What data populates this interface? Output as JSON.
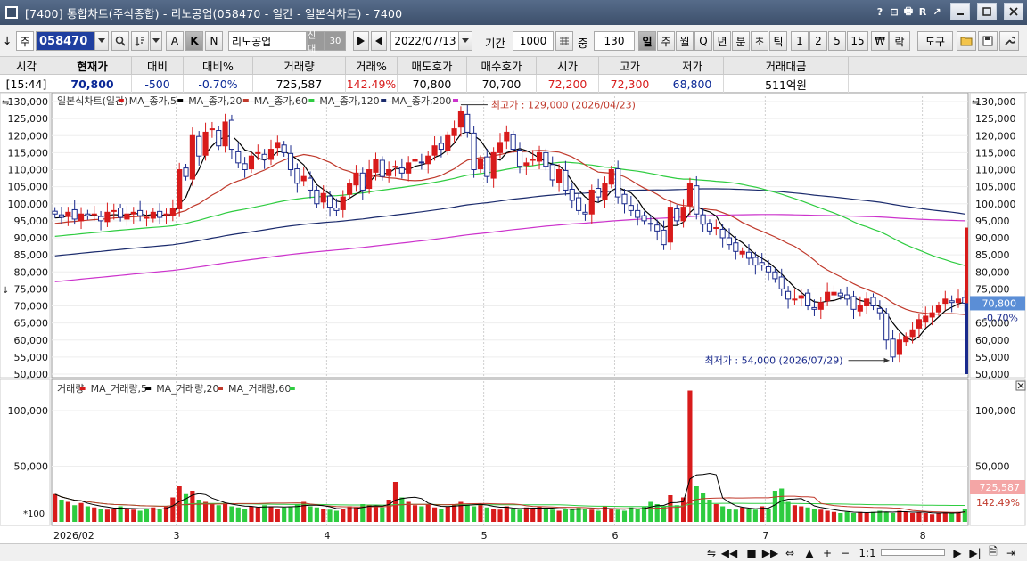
{
  "window": {
    "title": "[7400]  통합차트(주식종합) - 리노공업(058470 - 일간 - 일본식차트) - 7400",
    "title_buttons": [
      "?",
      "⊟",
      "🖶",
      "R",
      "↗"
    ]
  },
  "toolbar": {
    "arrow_left": "↓",
    "jong": "주",
    "code": "058470",
    "k": "K",
    "n": "N",
    "a": "A",
    "name": "리노공업",
    "tag_new": "신대",
    "tag_num": "30",
    "date": "2022/07/13",
    "period_label": "기간",
    "period_value": "1000",
    "count_label": "중",
    "count_value": "130",
    "intervals": [
      "일",
      "주",
      "월",
      "Q",
      "년",
      "분",
      "초",
      "틱",
      "1",
      "2",
      "5",
      "15",
      "₩",
      "락"
    ],
    "active_interval": "일",
    "tools_label": "도구"
  },
  "info": {
    "headers": [
      "시각",
      "현재가",
      "대비",
      "대비%",
      "거래량",
      "거래%",
      "매도호가",
      "매수호가",
      "시가",
      "고가",
      "저가",
      "거래대금"
    ],
    "values": [
      "[15:44]",
      "70,800",
      "-500",
      "-0.70%",
      "725,587",
      "142.49%",
      "70,800",
      "70,700",
      "72,200",
      "72,300",
      "68,800",
      "511억원"
    ],
    "colors": [
      "#000",
      "#0a2896",
      "#0a2896",
      "#0a2896",
      "#000",
      "#d81b1b",
      "#000",
      "#000",
      "#d81b1b",
      "#d81b1b",
      "#0a2896",
      "#000"
    ]
  },
  "price_panel": {
    "legend": [
      {
        "text": "일본식차트(일간)",
        "color": "#d81b1b"
      },
      {
        "text": "MA_종가,5",
        "color": "#000000"
      },
      {
        "text": "MA_종가,20",
        "color": "#c0392b"
      },
      {
        "text": "MA_종가,60",
        "color": "#2ecc40"
      },
      {
        "text": "MA_종가,120",
        "color": "#1a2a6c"
      },
      {
        "text": "MA_종가,200",
        "color": "#cc33cc"
      }
    ],
    "high_annotation": "최고가 : 129,000 (2026/04/23)",
    "low_annotation": "최저가 : 54,000 (2026/07/29)",
    "current_label": "70,800",
    "change_label": "-0.70%"
  },
  "volume_panel": {
    "legend": [
      {
        "text": "거래량",
        "color": "#d81b1b"
      },
      {
        "text": "MA_거래량,5",
        "color": "#000000"
      },
      {
        "text": "MA_거래량,20",
        "color": "#c0392b"
      },
      {
        "text": "MA_거래량,60",
        "color": "#2ecc40"
      }
    ],
    "unit_label": "*100",
    "current_label": "725,587",
    "pct_label": "142.49%"
  },
  "chart_data": {
    "type": "candlestick",
    "price_axis": {
      "ylim": [
        50000,
        130000
      ],
      "ticks": [
        50000,
        55000,
        60000,
        65000,
        70000,
        75000,
        80000,
        85000,
        90000,
        95000,
        100000,
        105000,
        110000,
        115000,
        120000,
        125000,
        130000
      ]
    },
    "volume_axis": {
      "ylim": [
        0,
        120000
      ],
      "ticks": [
        50000,
        100000
      ]
    },
    "x_labels": [
      {
        "text": "2026/02",
        "index": 0
      },
      {
        "text": "3",
        "index": 19
      },
      {
        "text": "4",
        "index": 42
      },
      {
        "text": "5",
        "index": 66
      },
      {
        "text": "6",
        "index": 86
      },
      {
        "text": "7",
        "index": 109
      },
      {
        "text": "8",
        "index": 133
      }
    ],
    "ma_colors": {
      "ma5": "#000000",
      "ma20": "#c0392b",
      "ma60": "#2ecc40",
      "ma120": "#1a2a6c",
      "ma200": "#cc33cc"
    },
    "candle_colors": {
      "up": "#d81b1b",
      "down": "#1a2a8c"
    },
    "volume_colors": {
      "up": "#d81b1b",
      "down": "#2ecc40"
    },
    "closes": [
      97000,
      96000,
      97500,
      95500,
      97000,
      96500,
      97000,
      95000,
      97500,
      98000,
      96000,
      97000,
      97500,
      96500,
      96000,
      97500,
      96000,
      97000,
      98500,
      110000,
      108000,
      120000,
      114000,
      121000,
      122000,
      117000,
      124000,
      116000,
      112000,
      110000,
      114000,
      115000,
      113000,
      116000,
      118000,
      115000,
      110000,
      106000,
      108000,
      104000,
      100000,
      103000,
      99000,
      98000,
      102000,
      106000,
      109000,
      104000,
      110000,
      113000,
      108000,
      110000,
      111000,
      109000,
      112000,
      113000,
      112000,
      114000,
      117000,
      116000,
      120000,
      122000,
      127000,
      121000,
      110000,
      113000,
      108000,
      115000,
      118000,
      121000,
      116000,
      111000,
      112000,
      113000,
      115000,
      111000,
      107000,
      110000,
      104000,
      101000,
      98000,
      97000,
      104000,
      102000,
      106000,
      110000,
      102000,
      100000,
      98000,
      96000,
      95000,
      94000,
      92000,
      88000,
      99000,
      95000,
      99000,
      106000,
      97000,
      94000,
      92000,
      93000,
      90000,
      88000,
      86000,
      86000,
      84000,
      82000,
      82000,
      80000,
      78000,
      75000,
      72000,
      72000,
      73000,
      70000,
      69000,
      71000,
      74000,
      74000,
      73000,
      72000,
      69000,
      70000,
      72000,
      70000,
      68000,
      60000,
      55000,
      60000,
      61000,
      63000,
      66000,
      67000,
      68000,
      70000,
      72000,
      71000,
      72000,
      70800
    ],
    "volumes": [
      25000,
      20000,
      18000,
      15000,
      17000,
      14000,
      13000,
      12000,
      11000,
      12000,
      14000,
      12000,
      11000,
      10000,
      12000,
      13000,
      11000,
      14000,
      22000,
      32000,
      25000,
      28000,
      20000,
      18000,
      16000,
      15000,
      17000,
      14000,
      13000,
      12000,
      14000,
      13000,
      15000,
      14000,
      12000,
      13000,
      14000,
      16000,
      18000,
      14000,
      13000,
      12000,
      11000,
      10000,
      12000,
      14000,
      13000,
      16000,
      15000,
      14000,
      13000,
      20000,
      36000,
      22000,
      18000,
      15000,
      14000,
      16000,
      13000,
      12000,
      14000,
      16000,
      18000,
      15000,
      14000,
      16000,
      13000,
      12000,
      11000,
      14000,
      12000,
      11000,
      13000,
      12000,
      14000,
      12000,
      11000,
      10000,
      12000,
      11000,
      13000,
      12000,
      11000,
      10000,
      14000,
      12000,
      11000,
      10000,
      13000,
      12000,
      14000,
      18000,
      16000,
      14000,
      24000,
      15000,
      22000,
      118000,
      32000,
      26000,
      20000,
      16000,
      14000,
      12000,
      11000,
      13000,
      12000,
      11000,
      14000,
      12000,
      28000,
      30000,
      18000,
      15000,
      14000,
      13000,
      12000,
      11000,
      10000,
      9000,
      8000,
      9000,
      8000,
      9000,
      8000,
      9000,
      10000,
      9000,
      8000,
      10000,
      9000,
      8000,
      9000,
      8000,
      7000,
      8000,
      9000,
      8000,
      9000,
      12000
    ]
  }
}
